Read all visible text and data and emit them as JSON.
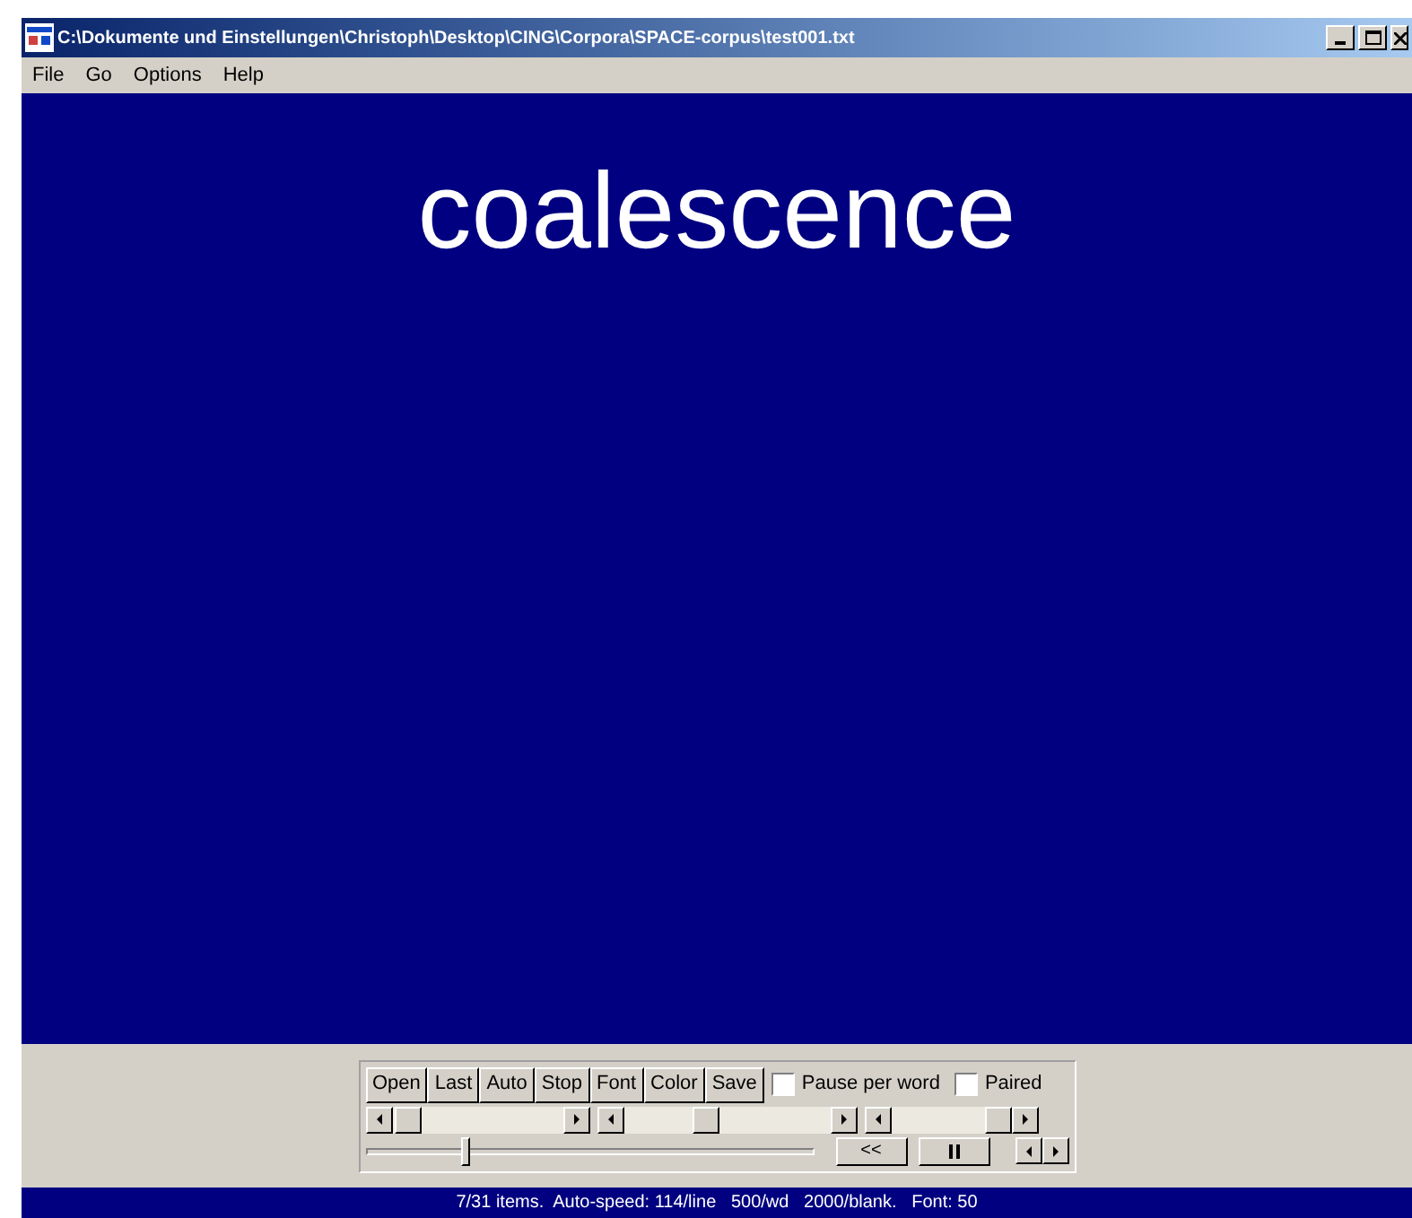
{
  "window": {
    "title": "C:\\Dokumente und Einstellungen\\Christoph\\Desktop\\CING\\Corpora\\SPACE-corpus\\test001.txt"
  },
  "menu": [
    "File",
    "Go",
    "Options",
    "Help"
  ],
  "display": {
    "word": "coalescence"
  },
  "buttons": [
    "Open",
    "Last",
    "Auto",
    "Stop",
    "Font",
    "Color",
    "Save"
  ],
  "checkboxes": [
    {
      "label": "Pause per word",
      "checked": false
    },
    {
      "label": "Paired",
      "checked": false
    }
  ],
  "scrollbars": [
    {
      "level": 0.02
    },
    {
      "level": 0.38
    },
    {
      "level": 1
    }
  ],
  "slider": {
    "level": 0.22
  },
  "nav_buttons": [
    {
      "kind": "text",
      "label": "<<"
    },
    {
      "kind": "pause"
    }
  ],
  "status_bar": "7/31 items.  Auto-speed: 114/line   500/wd   2000/blank.   Font: 50"
}
